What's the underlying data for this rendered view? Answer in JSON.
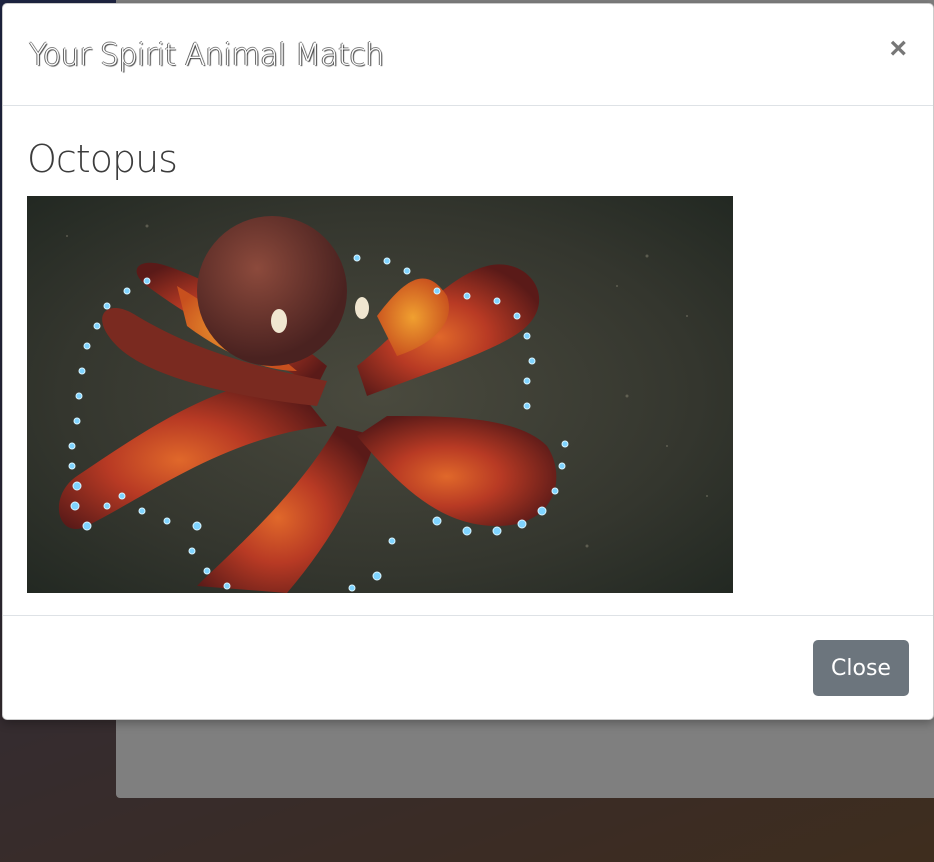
{
  "modal": {
    "title": "Your Spirit Animal Match",
    "close_icon": "×",
    "animal_name": "Octopus",
    "image_subject": "octopus-photo",
    "close_button_label": "Close"
  },
  "colors": {
    "close_button_bg": "#6c757d",
    "backdrop": "rgba(0,0,0,0.5)",
    "divider": "#dee2e6"
  }
}
